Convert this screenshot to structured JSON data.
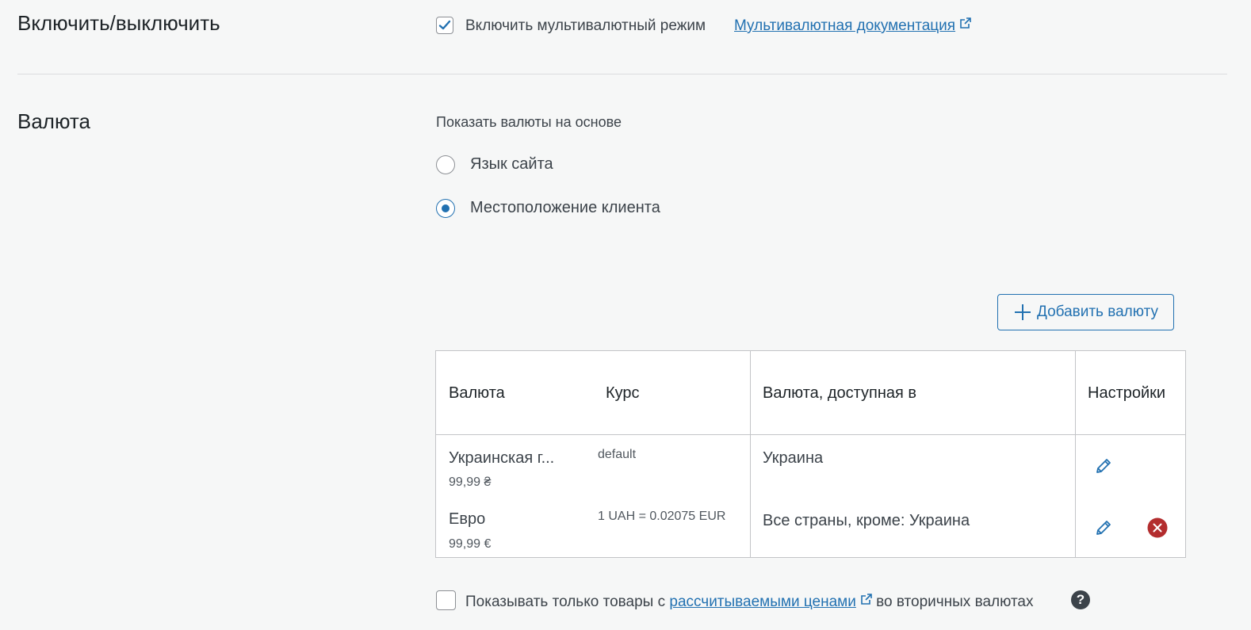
{
  "enable_section": {
    "title": "Включить/выключить",
    "checkbox_label": "Включить мультивалютный режим",
    "checked": true,
    "doc_link": "Мультивалютная документация"
  },
  "currency_section": {
    "title": "Валюта",
    "show_based_on_label": "Показать валюты на основе",
    "options": [
      {
        "label": "Язык сайта",
        "selected": false
      },
      {
        "label": "Местоположение клиента",
        "selected": true
      }
    ],
    "add_button_label": "Добавить валюту",
    "table": {
      "headers": {
        "currency": "Валюта",
        "rate": "Курс",
        "available_in": "Валюта, доступная в",
        "settings": "Настройки"
      },
      "rows": [
        {
          "name": "Украинская г...",
          "price": "99,99 ₴",
          "rate": "default",
          "available_in": "Украина",
          "deletable": false
        },
        {
          "name": "Евро",
          "price": "99,99 €",
          "rate": "1 UAH = 0.02075 EUR",
          "available_in": "Все страны, кроме: Украина",
          "deletable": true
        }
      ]
    },
    "footer": {
      "checked": false,
      "prefix": "Показывать только товары с",
      "link": "рассчитываемыми ценами",
      "suffix": "во вторичных валютах",
      "help_symbol": "?"
    }
  },
  "colors": {
    "accent": "#2271b1",
    "danger": "#b32d2e",
    "border": "#c3c4c7"
  }
}
